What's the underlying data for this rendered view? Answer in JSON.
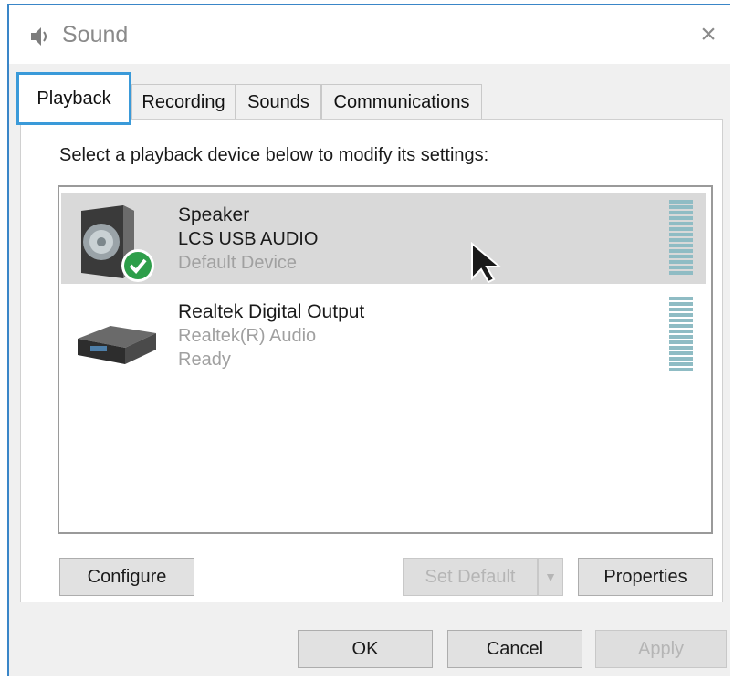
{
  "window": {
    "title": "Sound",
    "close_glyph": "×"
  },
  "tabs": [
    {
      "label": "Playback",
      "active": true
    },
    {
      "label": "Recording",
      "active": false
    },
    {
      "label": "Sounds",
      "active": false
    },
    {
      "label": "Communications",
      "active": false
    }
  ],
  "panel": {
    "instructions": "Select a playback device below to modify its settings:"
  },
  "devices": [
    {
      "name": "Speaker",
      "driver": "LCS USB AUDIO",
      "status": "Default Device",
      "selected": true,
      "icon": "speaker-icon",
      "badge": "default-check-icon"
    },
    {
      "name": "Realtek Digital Output",
      "driver": "Realtek(R) Audio",
      "status": "Ready",
      "selected": false,
      "icon": "digital-output-icon"
    }
  ],
  "buttons": {
    "configure": "Configure",
    "set_default": "Set Default",
    "set_default_arrow": "▼",
    "properties": "Properties",
    "ok": "OK",
    "cancel": "Cancel",
    "apply": "Apply"
  },
  "colors": {
    "accent": "#3a9ad9",
    "selection": "#d9d9d9",
    "check_badge": "#2e9e4a",
    "meter": "#8fbcc4"
  }
}
